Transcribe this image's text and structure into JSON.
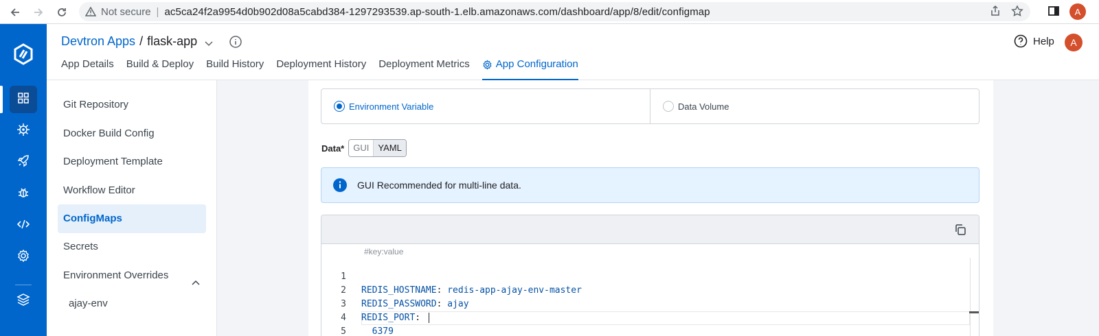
{
  "browser": {
    "security_label": "Not secure",
    "url": "ac5ca24f2a9954d0b902d08a5cabd384-1297293539.ap-south-1.elb.amazonaws.com/dashboard/app/8/edit/configmap",
    "profile_initial": "A"
  },
  "header": {
    "breadcrumb_root": "Devtron Apps",
    "breadcrumb_sep": "/",
    "app_name": "flask-app",
    "help_label": "Help",
    "avatar_initial": "A",
    "tabs": [
      {
        "label": "App Details"
      },
      {
        "label": "Build & Deploy"
      },
      {
        "label": "Build History"
      },
      {
        "label": "Deployment History"
      },
      {
        "label": "Deployment Metrics"
      },
      {
        "label": "App Configuration"
      }
    ]
  },
  "config_nav": {
    "items": [
      {
        "label": "Git Repository"
      },
      {
        "label": "Docker Build Config"
      },
      {
        "label": "Deployment Template"
      },
      {
        "label": "Workflow Editor"
      },
      {
        "label": "ConfigMaps"
      },
      {
        "label": "Secrets"
      },
      {
        "label": "Environment Overrides"
      }
    ],
    "sub_items": [
      {
        "label": "ajay-env"
      }
    ]
  },
  "form": {
    "usage_options": [
      {
        "label": "Environment Variable",
        "selected": true
      },
      {
        "label": "Data Volume",
        "selected": false
      }
    ],
    "data_label": "Data*",
    "mode_gui": "GUI",
    "mode_yaml": "YAML",
    "info_text": "GUI Recommended for multi-line data.",
    "editor": {
      "placeholder": "#key:value",
      "lines": [
        {
          "n": "1",
          "key": "REDIS_HOSTNAME",
          "colon": ":",
          "value": " redis-app-ajay-env-master"
        },
        {
          "n": "2",
          "key": "REDIS_PASSWORD",
          "colon": ":",
          "value": " ajay"
        },
        {
          "n": "3",
          "key": "REDIS_PORT",
          "colon": ":",
          "value": " "
        },
        {
          "n": "4",
          "key": "",
          "colon": "",
          "value": "  6379"
        },
        {
          "n": "5",
          "key": "",
          "colon": "",
          "value": ""
        }
      ]
    }
  },
  "colors": {
    "brand_blue": "#0066cc",
    "info_bg": "#e5f2ff",
    "avatar": "#d44f2b"
  }
}
